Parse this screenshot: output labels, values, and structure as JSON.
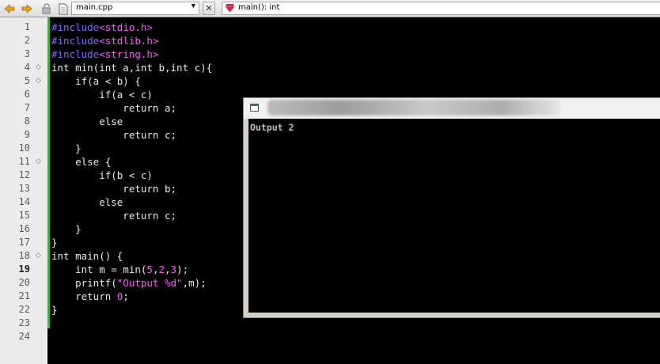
{
  "toolbar": {
    "file_tab": "main.cpp",
    "close_glyph": "✕",
    "function_selector": "main(): int",
    "icons": [
      "back-arrow-icon",
      "forward-arrow-icon",
      "lock-icon",
      "file-icon",
      "dropdown-caret-icon",
      "close-icon",
      "ruby-gem-icon"
    ]
  },
  "editor": {
    "current_line": 19,
    "line_numbers": [
      1,
      2,
      3,
      4,
      5,
      6,
      7,
      8,
      9,
      10,
      11,
      12,
      13,
      14,
      15,
      16,
      17,
      18,
      19,
      20,
      21,
      22,
      23,
      24
    ],
    "fold_markers": [
      4,
      5,
      11,
      18
    ],
    "lines": [
      "#include<stdio.h>",
      "#include<stdlib.h>",
      "#include<string.h>",
      "int min(int a,int b,int c){",
      "    if(a < b) {",
      "        if(a < c)",
      "            return a;",
      "        else",
      "            return c;",
      "    }",
      "    else {",
      "        if(b < c)",
      "            return b;",
      "        else",
      "            return c;",
      "    }",
      "}",
      "int main() {",
      "    int m = min(5,2,3);",
      "    printf(\"Output %d\",m);",
      "    return 0;",
      "}",
      "",
      ""
    ]
  },
  "console": {
    "output": "Output 2"
  },
  "colors": {
    "editor_bg": "#000000",
    "preprocessor": "#7b6cff",
    "literal": "#ff55ff",
    "default_text": "#e8e8e8",
    "change_marker": "#3bb33b"
  }
}
